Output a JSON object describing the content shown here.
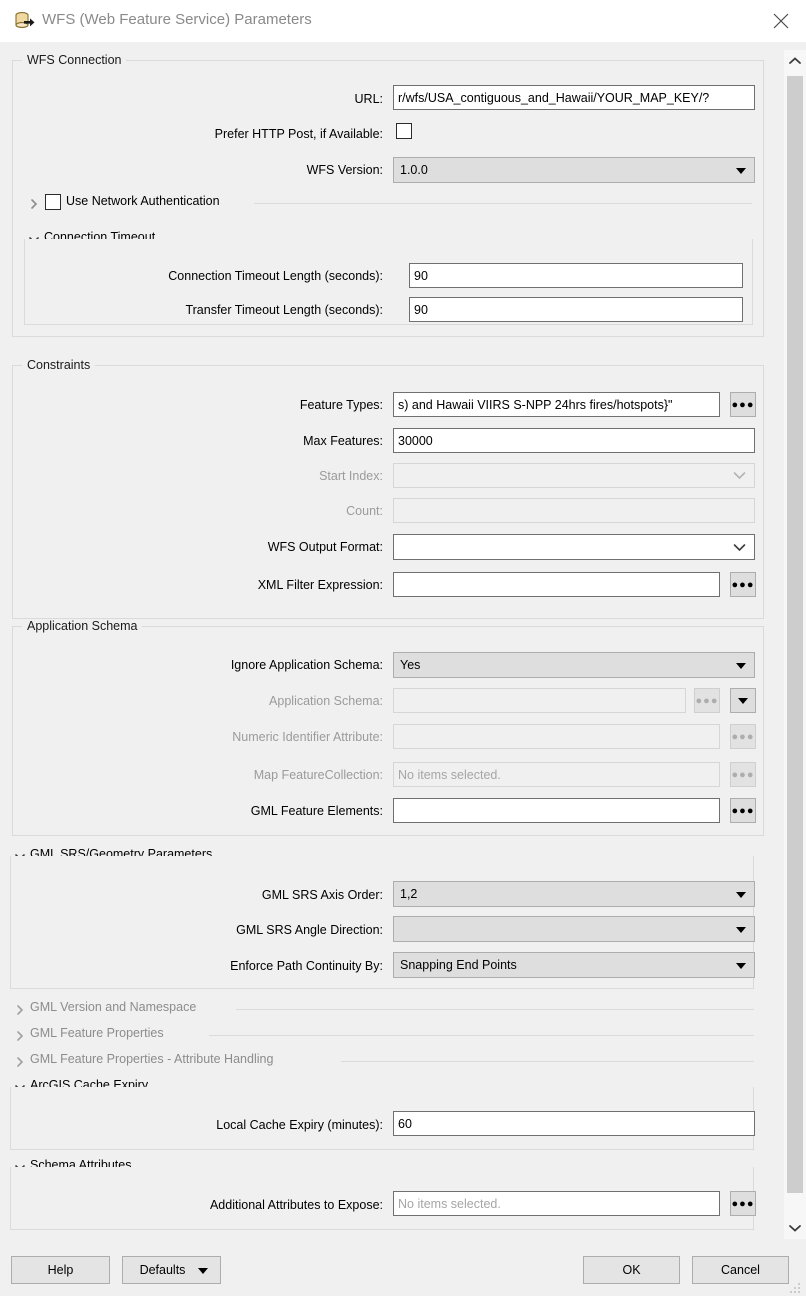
{
  "window": {
    "title": "WFS (Web Feature Service) Parameters",
    "icon": "database-export-icon",
    "close_label": "✕"
  },
  "sections": {
    "wfs_connection": {
      "title": "WFS Connection",
      "fields": {
        "url": {
          "label": "URL:",
          "value": "r/wfs/USA_contiguous_and_Hawaii/YOUR_MAP_KEY/?"
        },
        "prefer_http_post": {
          "label": "Prefer HTTP Post, if Available:",
          "checked": false
        },
        "wfs_version": {
          "label": "WFS Version:",
          "value": "1.0.0"
        },
        "use_network_auth": {
          "label": "Use Network Authentication",
          "checked": false
        }
      }
    },
    "connection_timeout": {
      "title": "Connection Timeout",
      "fields": {
        "connection_timeout_length": {
          "label": "Connection Timeout Length (seconds):",
          "value": "90"
        },
        "transfer_timeout_length": {
          "label": "Transfer Timeout Length (seconds):",
          "value": "90"
        }
      }
    },
    "constraints": {
      "title": "Constraints",
      "fields": {
        "feature_types": {
          "label": "Feature Types:",
          "value": "s) and Hawaii VIIRS S-NPP 24hrs fires/hotspots}\""
        },
        "max_features": {
          "label": "Max Features:",
          "value": "30000"
        },
        "start_index": {
          "label": "Start Index:",
          "value": ""
        },
        "count": {
          "label": "Count:",
          "value": ""
        },
        "wfs_output_format": {
          "label": "WFS Output Format:",
          "value": ""
        },
        "xml_filter_expression": {
          "label": "XML Filter Expression:",
          "value": ""
        }
      }
    },
    "application_schema": {
      "title": "Application Schema",
      "fields": {
        "ignore_application_schema": {
          "label": "Ignore Application Schema:",
          "value": "Yes"
        },
        "application_schema": {
          "label": "Application Schema:",
          "value": ""
        },
        "numeric_identifier_attribute": {
          "label": "Numeric Identifier Attribute:",
          "value": ""
        },
        "map_featurecollection": {
          "label": "Map FeatureCollection:",
          "value": "No items selected."
        },
        "gml_feature_elements": {
          "label": "GML Feature Elements:",
          "value": ""
        }
      }
    },
    "gml_srs_geometry": {
      "title": "GML SRS/Geometry Parameters",
      "fields": {
        "gml_srs_axis_order": {
          "label": "GML SRS Axis Order:",
          "value": "1,2"
        },
        "gml_srs_angle_direction": {
          "label": "GML SRS Angle Direction:",
          "value": ""
        },
        "enforce_path_continuity_by": {
          "label": "Enforce Path Continuity By:",
          "value": "Snapping End Points"
        }
      }
    },
    "collapsed": [
      {
        "label": "GML Version and Namespace"
      },
      {
        "label": "GML Feature Properties"
      },
      {
        "label": "GML Feature Properties - Attribute Handling"
      }
    ],
    "arcgis_cache_expiry": {
      "title": "ArcGIS Cache Expiry",
      "fields": {
        "local_cache_expiry": {
          "label": "Local Cache Expiry (minutes):",
          "value": "60"
        }
      }
    },
    "schema_attributes": {
      "title": "Schema Attributes",
      "fields": {
        "additional_attributes_to_expose": {
          "label": "Additional Attributes to Expose:",
          "value": "No items selected."
        }
      }
    }
  },
  "footer": {
    "help": "Help",
    "defaults": "Defaults",
    "ok": "OK",
    "cancel": "Cancel"
  },
  "colors": {
    "window_bg": "#f0f0f0",
    "titlebar_bg": "#ffffff",
    "title_text": "#8a8a8a",
    "field_border": "#707070",
    "disabled_text": "#9b9b9b",
    "combo_bg": "#dedede",
    "scroll_thumb": "#cdcdcd"
  }
}
